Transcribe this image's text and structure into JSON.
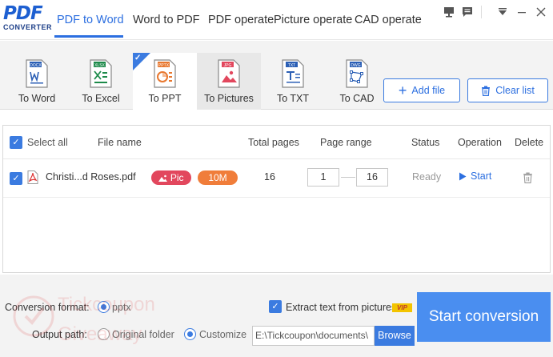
{
  "app": {
    "logo_main": "PDF",
    "logo_sub": "CONVERTER",
    "accent_color": "#2c6fe0"
  },
  "menu": {
    "tabs": [
      {
        "label": "PDF to Word",
        "active": true
      },
      {
        "label": "Word to PDF"
      },
      {
        "label": "PDF operate"
      },
      {
        "label": "Picture operate"
      },
      {
        "label": "CAD operate"
      }
    ]
  },
  "toolbar": {
    "formats": [
      {
        "label": "To Word",
        "badge": "DOCX",
        "badge_color": "#2b5fb5",
        "icon": "word-file-icon"
      },
      {
        "label": "To Excel",
        "badge": "XLSX",
        "badge_color": "#1d8a4a",
        "icon": "excel-file-icon"
      },
      {
        "label": "To PPT",
        "badge": "PPTX",
        "badge_color": "#e8772e",
        "icon": "ppt-file-icon",
        "selected": true
      },
      {
        "label": "To Pictures",
        "badge": "JPG",
        "badge_color": "#e2475d",
        "icon": "image-file-icon"
      },
      {
        "label": "To TXT",
        "badge": "TXT",
        "badge_color": "#2b5fb5",
        "icon": "txt-file-icon"
      },
      {
        "label": "To CAD",
        "badge": "DWG",
        "badge_color": "#2b5fb5",
        "icon": "cad-file-icon"
      }
    ],
    "add_file": "Add file",
    "clear_list": "Clear list"
  },
  "file_list": {
    "headers": {
      "select_all": "Select all",
      "file_name": "File name",
      "total_pages": "Total pages",
      "page_range": "Page range",
      "status": "Status",
      "operation": "Operation",
      "delete": "Delete"
    },
    "rows": [
      {
        "file_name": "Christi...d Roses.pdf",
        "tag_pic": "Pic",
        "tag_size": "10M",
        "total_pages": "16",
        "range_from": "1",
        "range_to": "16",
        "status": "Ready",
        "operation": "Start"
      }
    ]
  },
  "bottom": {
    "conversion_format_label": "Conversion format:",
    "conversion_format_value": "pptx",
    "extract_text_label": "Extract text from pictures",
    "vip_badge": "VIP",
    "output_path_label": "Output path:",
    "original_folder": "Original folder",
    "customize": "Customize",
    "path_value": "E:\\Tickcoupon\\documents\\",
    "browse": "Browse",
    "start_conversion": "Start conversion"
  },
  "watermark": {
    "line1": "Tickcoupon",
    "line2": "Giveaway"
  }
}
